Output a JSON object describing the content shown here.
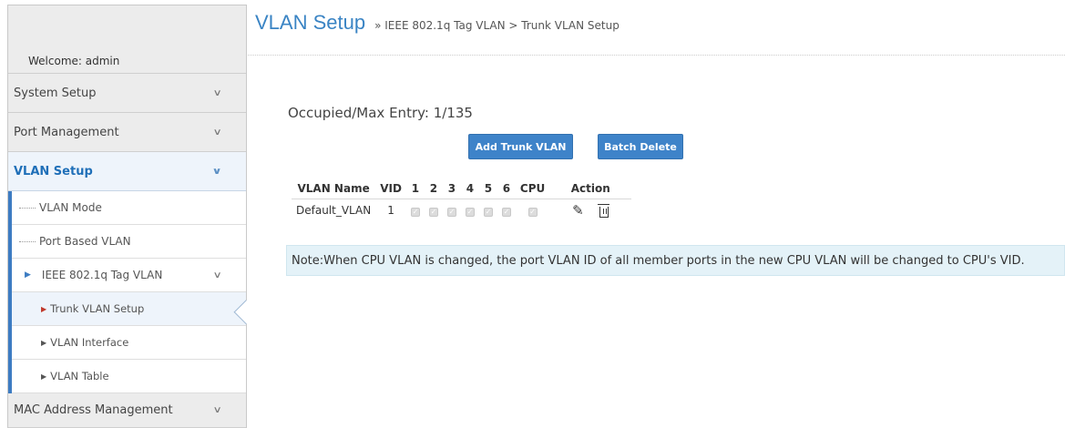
{
  "sidebar": {
    "welcome": "Welcome: admin",
    "menu": [
      {
        "label": "System Setup"
      },
      {
        "label": "Port Management"
      },
      {
        "label": "VLAN Setup"
      }
    ],
    "sub": {
      "vlan_mode": "VLAN Mode",
      "port_based": "Port Based VLAN",
      "ieee": "IEEE 802.1q Tag VLAN",
      "trunk": "Trunk VLAN Setup",
      "iface": "VLAN Interface",
      "table": "VLAN Table"
    },
    "mac": "MAC Address Management"
  },
  "header": {
    "title": "VLAN Setup",
    "breadcrumb": "» IEEE 802.1q Tag VLAN > Trunk VLAN Setup"
  },
  "occupied": "Occupied/Max Entry: 1/135",
  "buttons": {
    "add": "Add Trunk VLAN",
    "delete": "Batch Delete"
  },
  "table": {
    "headers": [
      "VLAN Name",
      "VID",
      "1",
      "2",
      "3",
      "4",
      "5",
      "6",
      "CPU",
      "Action"
    ],
    "rows": [
      {
        "name": "Default_VLAN",
        "vid": "1"
      }
    ]
  },
  "note": "Note:When CPU VLAN is changed, the port VLAN ID of all member ports in the new CPU VLAN will be changed to CPU's VID.",
  "colors": {
    "accent": "#3e83c9",
    "title": "#3a84c4",
    "note_bg": "#e4f2f8"
  },
  "icons": {
    "chevron": "chevron-down-icon",
    "edit": "pencil-icon",
    "delete": "trash-icon"
  }
}
